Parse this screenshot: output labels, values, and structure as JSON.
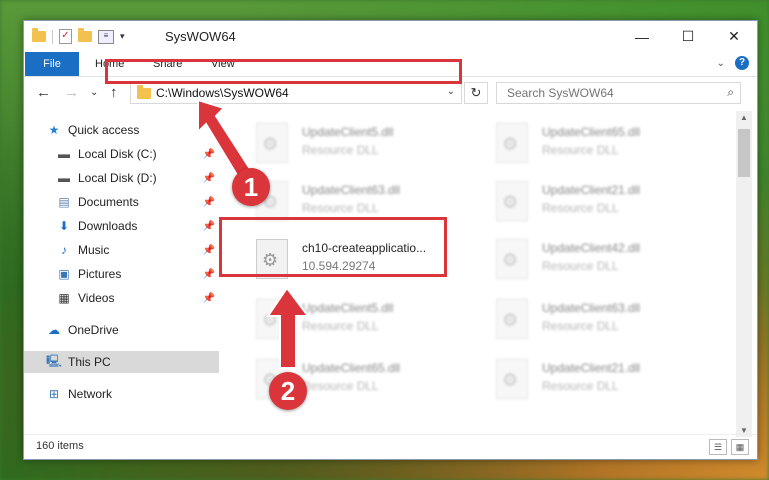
{
  "window": {
    "title": "SysWOW64",
    "minimize": "—",
    "maximize": "☐",
    "close": "✕"
  },
  "ribbon": {
    "file_tab": "File",
    "tabs": [
      "Home",
      "Share",
      "View"
    ],
    "expand": "⌄",
    "help": "?"
  },
  "nav": {
    "back": "←",
    "forward": "→",
    "recent": "⌄",
    "up": "↑",
    "address": "C:\\Windows\\SysWOW64",
    "refresh": "↻",
    "search_placeholder": "Search SysWOW64"
  },
  "sidebar": {
    "items": [
      {
        "label": "Quick access",
        "icon": "star-icon",
        "pinned": false
      },
      {
        "label": "Local Disk (C:)",
        "icon": "drive-icon",
        "pinned": true
      },
      {
        "label": "Local Disk (D:)",
        "icon": "drive-icon",
        "pinned": true
      },
      {
        "label": "Documents",
        "icon": "documents-icon",
        "pinned": true
      },
      {
        "label": "Downloads",
        "icon": "download-icon",
        "pinned": true
      },
      {
        "label": "Music",
        "icon": "music-icon",
        "pinned": true
      },
      {
        "label": "Pictures",
        "icon": "pictures-icon",
        "pinned": true
      },
      {
        "label": "Videos",
        "icon": "videos-icon",
        "pinned": true
      },
      {
        "label": "OneDrive",
        "icon": "cloud-icon",
        "pinned": false
      },
      {
        "label": "This PC",
        "icon": "computer-icon",
        "pinned": false,
        "selected": true
      },
      {
        "label": "Network",
        "icon": "network-icon",
        "pinned": false
      }
    ]
  },
  "files": [
    {
      "name": "UpdateClient5.dll",
      "type": "Resource DLL",
      "blurred": true
    },
    {
      "name": "UpdateClient65.dll",
      "type": "Resource DLL",
      "blurred": true
    },
    {
      "name": "UpdateClient63.dll",
      "type": "Resource DLL",
      "blurred": true
    },
    {
      "name": "UpdateClient21.dll",
      "type": "Resource DLL",
      "blurred": true
    },
    {
      "name": "ch10-createapplicatio...",
      "type": "10.594.29274",
      "blurred": false
    },
    {
      "name": "UpdateClient42.dll",
      "type": "Resource DLL",
      "blurred": true
    },
    {
      "name": "UpdateClient5.dll",
      "type": "Resource DLL",
      "blurred": true
    },
    {
      "name": "UpdateClient63.dll",
      "type": "Resource DLL",
      "blurred": true
    },
    {
      "name": "UpdateClient65.dll",
      "type": "Resource DLL",
      "blurred": true
    },
    {
      "name": "UpdateClient21.dll",
      "type": "Resource DLL",
      "blurred": true
    }
  ],
  "status": {
    "items_count": "160 items"
  },
  "annotations": {
    "step1": "1",
    "step2": "2",
    "color": "#d9353a"
  }
}
